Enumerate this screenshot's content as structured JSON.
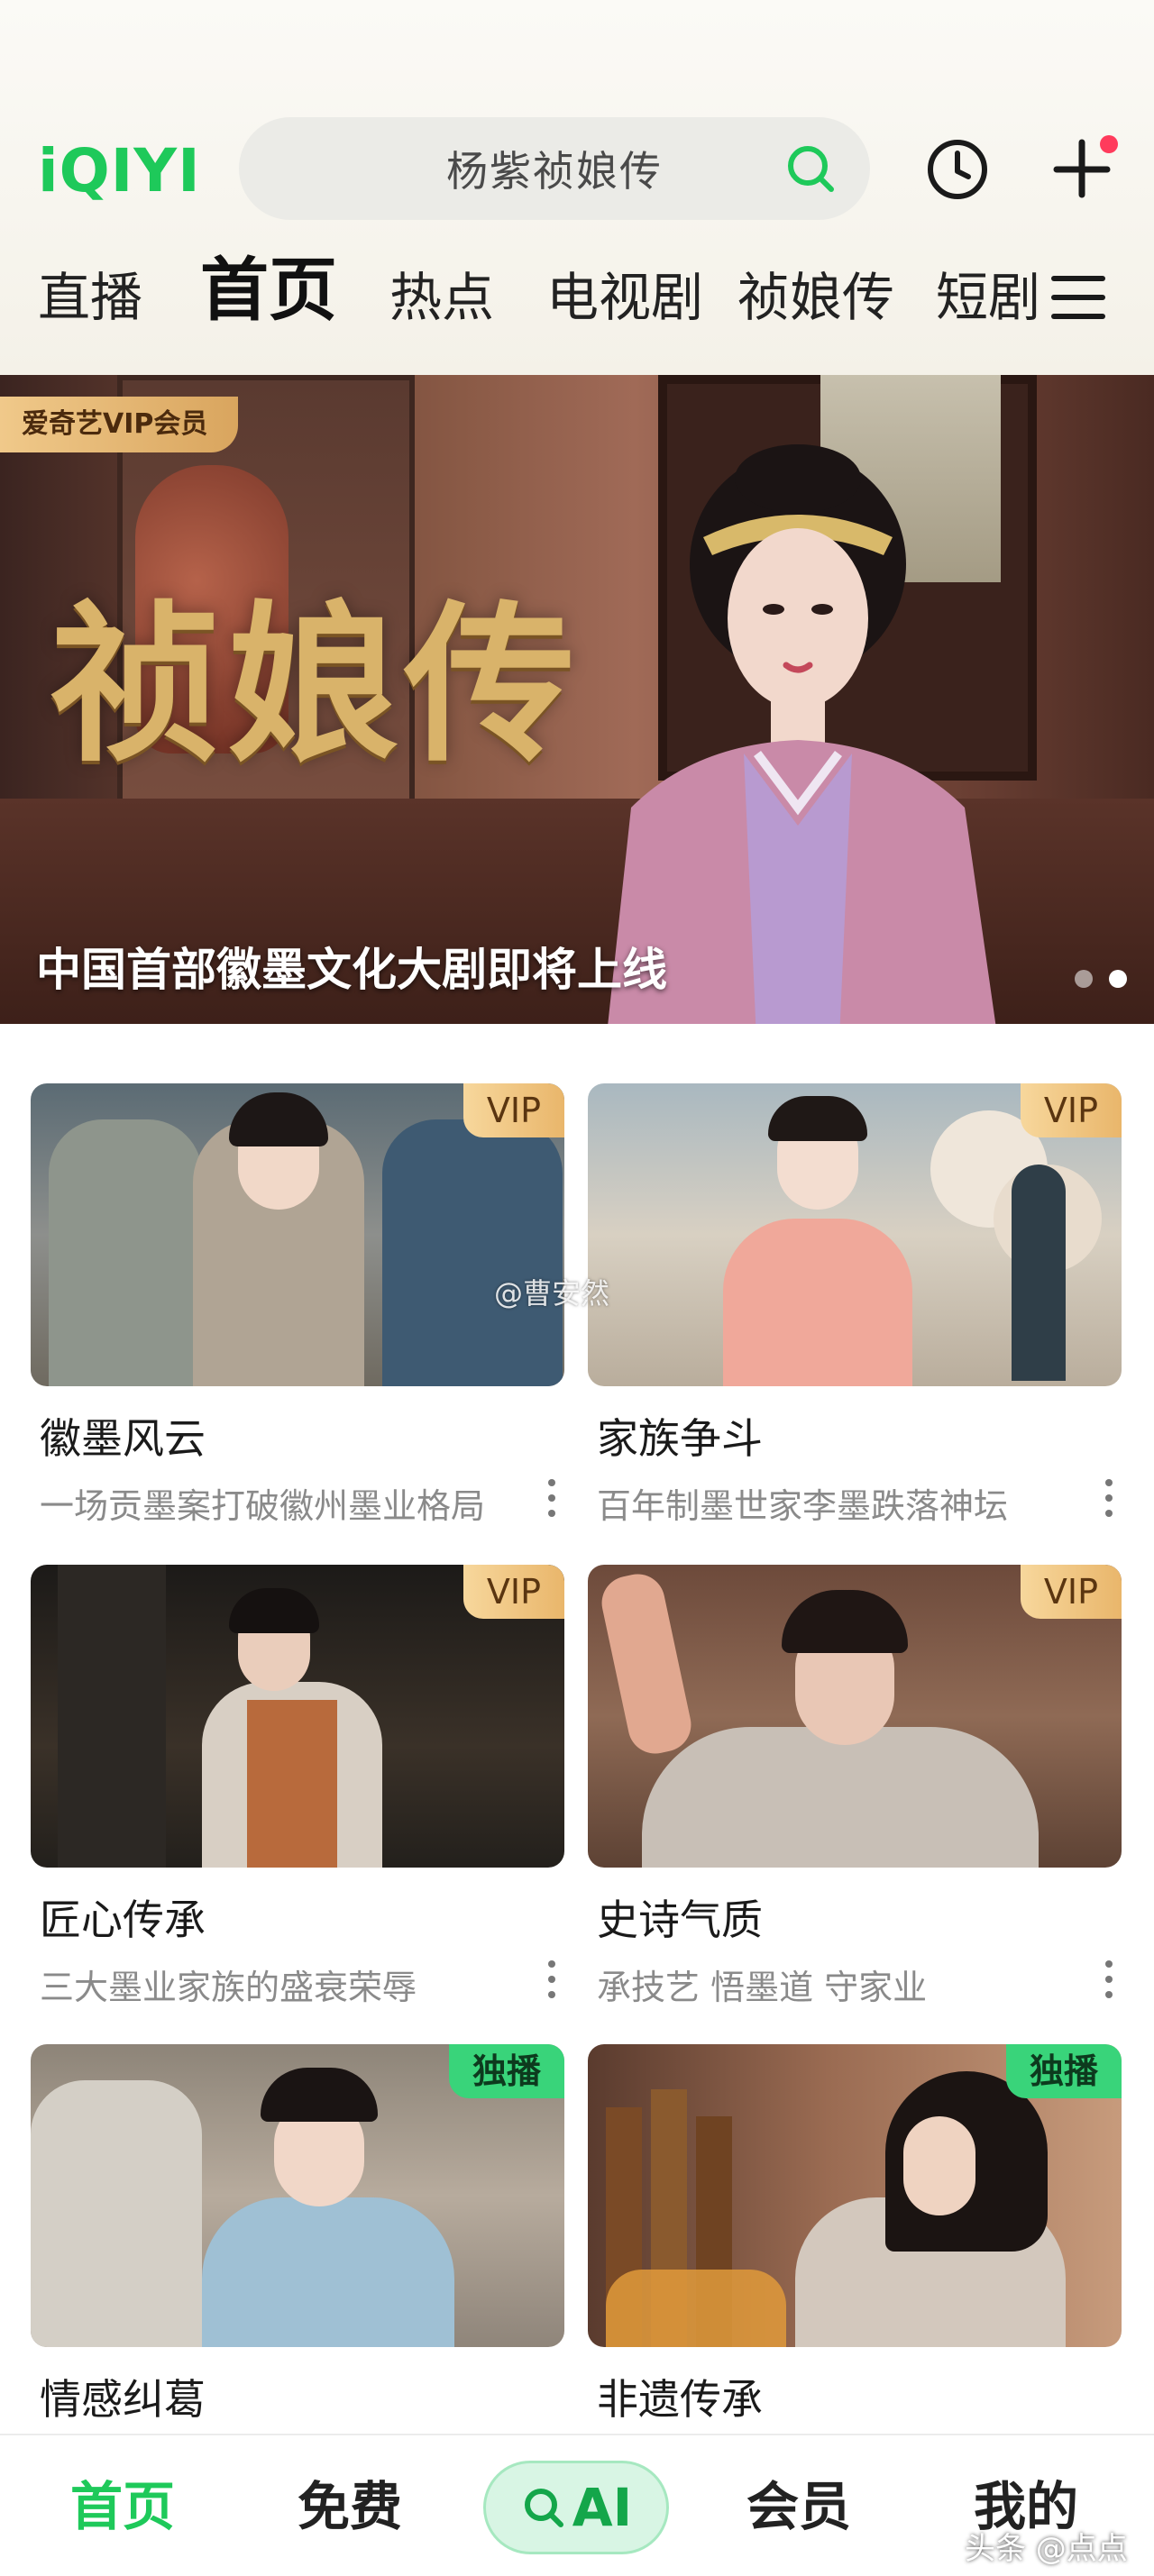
{
  "header": {
    "logo": "iQIYI",
    "search": {
      "value": "杨紫祯娘传"
    },
    "icons": [
      "search-icon",
      "history-icon",
      "plus-icon",
      "menu-icon"
    ]
  },
  "nav": {
    "items": [
      {
        "label": "直播",
        "active": false
      },
      {
        "label": "首页",
        "active": true
      },
      {
        "label": "热点",
        "active": false
      },
      {
        "label": "电视剧",
        "active": false
      },
      {
        "label": "祯娘传",
        "active": false
      },
      {
        "label": "短剧",
        "active": false
      }
    ]
  },
  "banner": {
    "tag": "爱奇艺VIP会员",
    "title": "祯娘传",
    "caption": "中国首部徽墨文化大剧即将上线",
    "slides": 2,
    "current_slide": 2
  },
  "cards": [
    {
      "title": "徽墨风云",
      "subtitle": "一场贡墨案打破徽州墨业格局",
      "badge": "VIP",
      "badge_type": "vip"
    },
    {
      "title": "家族争斗",
      "subtitle": "百年制墨世家李墨跌落神坛",
      "badge": "VIP",
      "badge_type": "vip"
    },
    {
      "title": "匠心传承",
      "subtitle": "三大墨业家族的盛衰荣辱",
      "badge": "VIP",
      "badge_type": "vip"
    },
    {
      "title": "史诗气质",
      "subtitle": "承技艺 悟墨道 守家业",
      "badge": "VIP",
      "badge_type": "vip"
    },
    {
      "title": "情感纠葛",
      "subtitle": "",
      "badge": "独播",
      "badge_type": "exclusive"
    },
    {
      "title": "非遗传承",
      "subtitle": "",
      "badge": "独播",
      "badge_type": "exclusive"
    }
  ],
  "image_watermark": "@曹安然",
  "bottom_tabs": [
    {
      "label": "首页",
      "active": true
    },
    {
      "label": "免费",
      "active": false
    },
    {
      "label": "AI",
      "active": false
    },
    {
      "label": "会员",
      "active": false
    },
    {
      "label": "我的",
      "active": false
    }
  ],
  "corner_watermark": "头条 @点点",
  "colors": {
    "brand": "#1ec95a",
    "vip_gold": "#e9b66b",
    "exclusive_green": "#39d47a",
    "notify_dot": "#ff3b5c"
  }
}
